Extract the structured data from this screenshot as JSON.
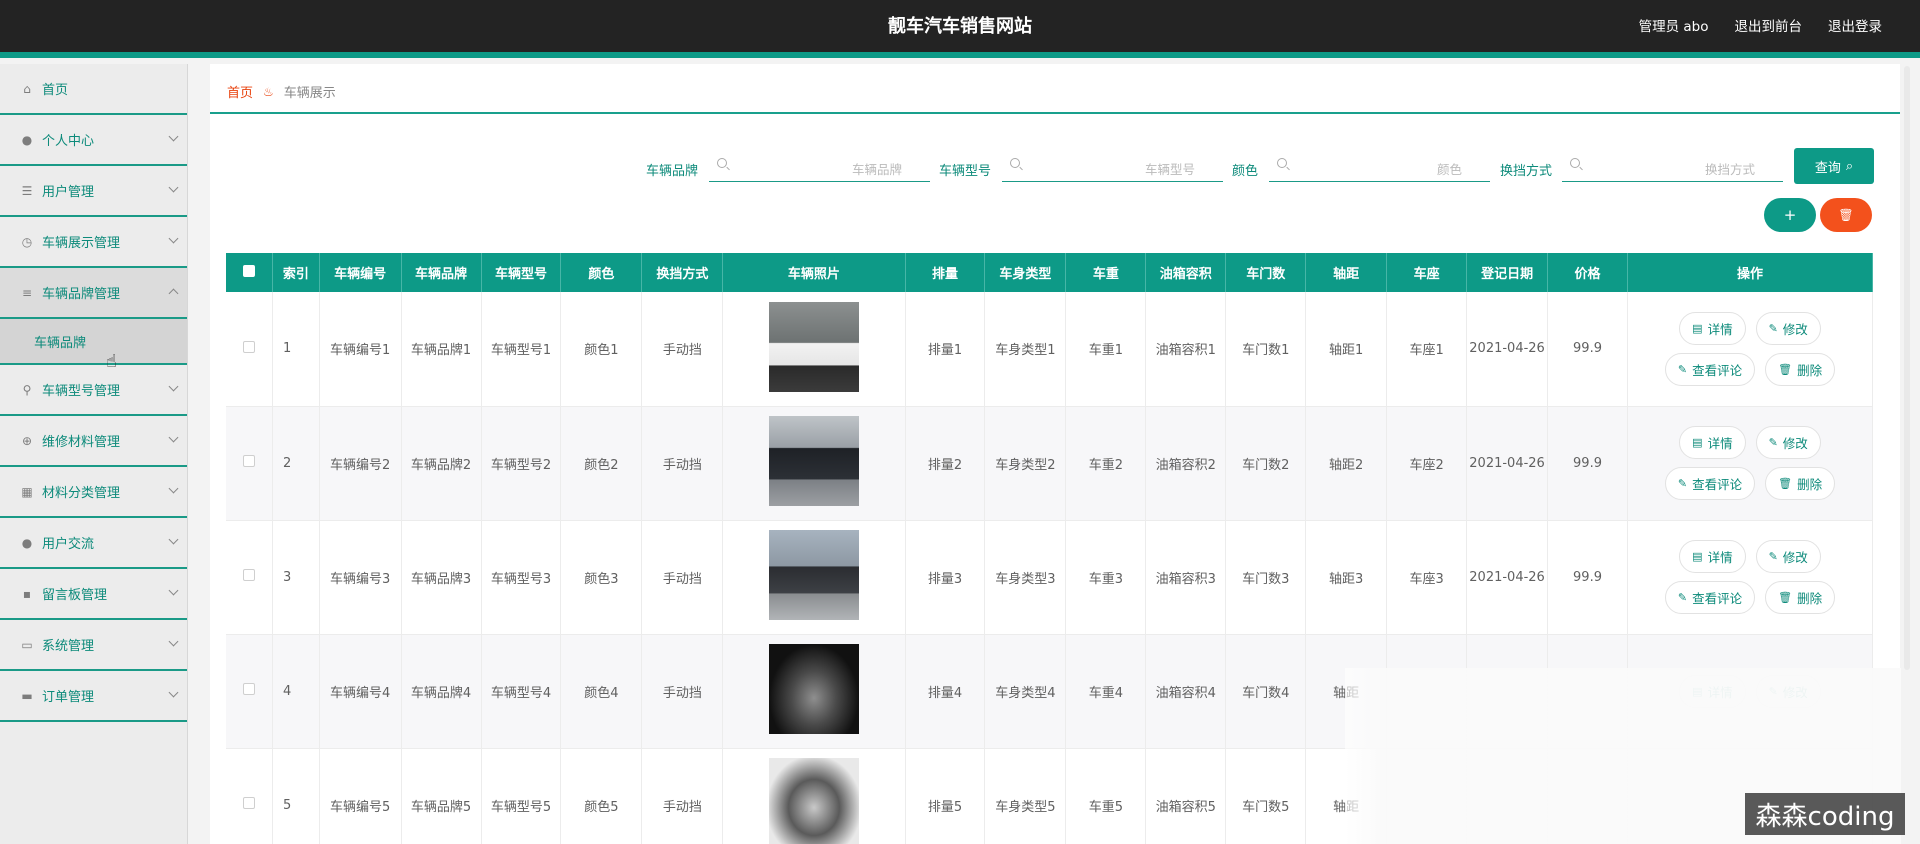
{
  "header": {
    "title": "靓车汽车销售网站",
    "user": "管理员 abo",
    "back_to_front": "退出到前台",
    "logout": "退出登录"
  },
  "sidebar": {
    "items": [
      {
        "label": "首页",
        "icon": "home-icon",
        "glyph": "⌂"
      },
      {
        "label": "个人中心",
        "icon": "user-icon",
        "glyph": "●"
      },
      {
        "label": "用户管理",
        "icon": "list-icon",
        "glyph": "☰"
      },
      {
        "label": "车辆展示管理",
        "icon": "clock-icon",
        "glyph": "◷"
      },
      {
        "label": "车辆品牌管理",
        "icon": "sliders-icon",
        "glyph": "≡"
      },
      {
        "label": "车辆型号管理",
        "icon": "pin-icon",
        "glyph": "⚲"
      },
      {
        "label": "维修材料管理",
        "icon": "cross-circle-icon",
        "glyph": "⊕"
      },
      {
        "label": "材料分类管理",
        "icon": "grid-icon",
        "glyph": "▦"
      },
      {
        "label": "用户交流",
        "icon": "user-icon",
        "glyph": "●"
      },
      {
        "label": "留言板管理",
        "icon": "apps-icon",
        "glyph": "▪"
      },
      {
        "label": "系统管理",
        "icon": "chat-icon",
        "glyph": "▭"
      },
      {
        "label": "订单管理",
        "icon": "message-icon",
        "glyph": "▬"
      }
    ],
    "submenu_label": "车辆品牌"
  },
  "breadcrumb": {
    "home": "首页",
    "current": "车辆展示"
  },
  "filters": {
    "brand_label": "车辆品牌",
    "brand_placeholder": "车辆品牌",
    "model_label": "车辆型号",
    "model_placeholder": "车辆型号",
    "color_label": "颜色",
    "color_placeholder": "颜色",
    "gear_label": "换挡方式",
    "gear_placeholder": "换挡方式",
    "query_label": "查询"
  },
  "actions": {
    "add": "+",
    "delete": "🗑"
  },
  "table": {
    "headers": [
      "索引",
      "车辆编号",
      "车辆品牌",
      "车辆型号",
      "颜色",
      "换挡方式",
      "车辆照片",
      "排量",
      "车身类型",
      "车重",
      "油箱容积",
      "车门数",
      "轴距",
      "车座",
      "登记日期",
      "价格",
      "操作"
    ],
    "rows": [
      {
        "idx": "1",
        "num": "车辆编号1",
        "brand": "车辆品牌1",
        "model": "车辆型号1",
        "color": "颜色1",
        "gear": "手动挡",
        "disp": "排量1",
        "body": "车身类型1",
        "weight": "车重1",
        "tank": "油箱容积1",
        "doors": "车门数1",
        "wheelbase": "轴距1",
        "seats": "车座1",
        "date": "2021-04-26",
        "price": "99.9"
      },
      {
        "idx": "2",
        "num": "车辆编号2",
        "brand": "车辆品牌2",
        "model": "车辆型号2",
        "color": "颜色2",
        "gear": "手动挡",
        "disp": "排量2",
        "body": "车身类型2",
        "weight": "车重2",
        "tank": "油箱容积2",
        "doors": "车门数2",
        "wheelbase": "轴距2",
        "seats": "车座2",
        "date": "2021-04-26",
        "price": "99.9"
      },
      {
        "idx": "3",
        "num": "车辆编号3",
        "brand": "车辆品牌3",
        "model": "车辆型号3",
        "color": "颜色3",
        "gear": "手动挡",
        "disp": "排量3",
        "body": "车身类型3",
        "weight": "车重3",
        "tank": "油箱容积3",
        "doors": "车门数3",
        "wheelbase": "轴距3",
        "seats": "车座3",
        "date": "2021-04-26",
        "price": "99.9"
      },
      {
        "idx": "4",
        "num": "车辆编号4",
        "brand": "车辆品牌4",
        "model": "车辆型号4",
        "color": "颜色4",
        "gear": "手动挡",
        "disp": "排量4",
        "body": "车身类型4",
        "weight": "车重4",
        "tank": "油箱容积4",
        "doors": "车门数4",
        "wheelbase": "轴距",
        "seats": "",
        "date": "",
        "price": ""
      },
      {
        "idx": "5",
        "num": "车辆编号5",
        "brand": "车辆品牌5",
        "model": "车辆型号5",
        "color": "颜色5",
        "gear": "手动挡",
        "disp": "排量5",
        "body": "车身类型5",
        "weight": "车重5",
        "tank": "油箱容积5",
        "doors": "车门数5",
        "wheelbase": "轴距",
        "seats": "",
        "date": "",
        "price": ""
      }
    ],
    "op_labels": {
      "detail": "详情",
      "edit": "修改",
      "review": "查看评论",
      "delete": "删除"
    }
  },
  "colors": {
    "accent": "#0d9a87",
    "danger": "#f3511c",
    "header_bg": "#232323"
  },
  "watermark": "森森coding"
}
